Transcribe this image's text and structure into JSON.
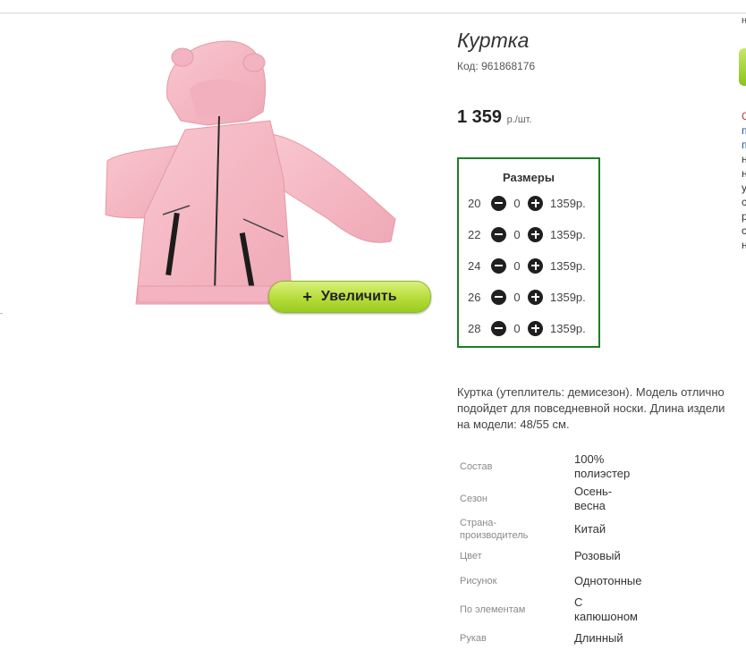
{
  "product": {
    "title": "Куртка",
    "code": "Код: 961868176",
    "price_value": "1 359",
    "price_unit": "р./шт."
  },
  "zoom_button": {
    "label": "Увеличить",
    "icon": "plus-icon"
  },
  "sizes": {
    "heading": "Размеры",
    "rows": [
      {
        "size": "20",
        "qty": "0",
        "price": "1359р."
      },
      {
        "size": "22",
        "qty": "0",
        "price": "1359р."
      },
      {
        "size": "24",
        "qty": "0",
        "price": "1359р."
      },
      {
        "size": "26",
        "qty": "0",
        "price": "1359р."
      },
      {
        "size": "28",
        "qty": "0",
        "price": "1359р."
      }
    ]
  },
  "description": {
    "lines": [
      "Куртка (утеплитель: демисезон). Модель отлично",
      "подойдет для повседневной носки. Длина издели",
      "на модели: 48/55 см."
    ]
  },
  "specs": [
    {
      "label": "Состав",
      "value_lines": [
        "100%",
        "полиэстер"
      ]
    },
    {
      "label": "Сезон",
      "value_lines": [
        "Осень-",
        "весна"
      ]
    },
    {
      "label_lines": [
        "Страна-",
        "производитель"
      ],
      "value_lines": [
        "Китай"
      ]
    },
    {
      "label": "Цвет",
      "value_lines": [
        "Розовый"
      ]
    },
    {
      "label": "Рисунок",
      "value_lines": [
        "Однотонные"
      ]
    },
    {
      "label": "По элементам",
      "value_lines": [
        "С",
        "капюшоном"
      ]
    },
    {
      "label": "Рукав",
      "value_lines": [
        "Длинный"
      ]
    }
  ],
  "right_edge_fragments": [
    "н",
    "С",
    "п",
    "п",
    "н",
    "н",
    "у",
    "с",
    "р",
    "с",
    "н"
  ],
  "colors": {
    "accent_green_border": "#1d7d26",
    "button_green": "#b6dc3a",
    "jacket_pink": "#f6b9c4"
  }
}
